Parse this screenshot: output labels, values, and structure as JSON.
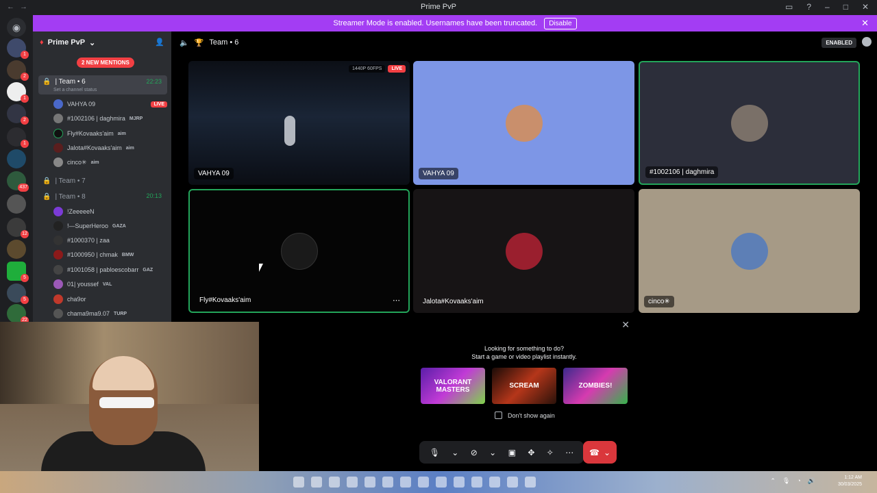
{
  "window": {
    "title": "Prime PvP"
  },
  "banner": {
    "text": "Streamer Mode is enabled. Usernames have been truncated.",
    "disable_label": "Disable"
  },
  "server_badges": [
    "1",
    "2",
    "1",
    "2",
    "1",
    "437",
    "12",
    "5",
    "5",
    "22"
  ],
  "sidebar": {
    "server_name": "Prime PvP",
    "mentions": "2 NEW MENTIONS",
    "channel_active": {
      "name": "| Team • 6",
      "time": "22:23",
      "status": "Set a channel status"
    },
    "users": [
      {
        "name": "VAHYA 09",
        "tag": "",
        "live": "LIVE"
      },
      {
        "name": "#1002106 | daghmira",
        "tag": "MJRP"
      },
      {
        "name": "Fly#Kovaaks'aim",
        "tag": "aim"
      },
      {
        "name": "Jalota#Kovaaks'aim",
        "tag": "aim"
      },
      {
        "name": "cinco✳",
        "tag": "aim"
      }
    ],
    "channel_7": "| Team • 7",
    "channel_8": {
      "name": "| Team • 8",
      "time": "20:13"
    },
    "users_8": [
      {
        "name": "!ZeeeeeN",
        "tag": ""
      },
      {
        "name": "!—SuperHeroo",
        "tag": "GAZA"
      },
      {
        "name": "#1000370 | zaa",
        "tag": ""
      },
      {
        "name": "#1000950 | chmak",
        "tag": "BMW"
      },
      {
        "name": "#1001058 | pabloescobarr",
        "tag": "GAZ"
      },
      {
        "name": "01| youssef",
        "tag": "VAL"
      },
      {
        "name": "cha9or",
        "tag": ""
      },
      {
        "name": "chama9ma9.07",
        "tag": "TURP"
      }
    ]
  },
  "main": {
    "header_title": "Team • 6",
    "enabled_label": "ENABLED",
    "tiles": [
      {
        "name": "VAHYA 09",
        "stream_res": "1440P 60FPS",
        "live": "LIVE"
      },
      {
        "name": "VAHYA 09"
      },
      {
        "name": "#1002106 | daghmira"
      },
      {
        "name": "Fly#Kovaaks'aim"
      },
      {
        "name": "Jalota#Kovaaks'aim"
      },
      {
        "name": "cinco✳"
      }
    ]
  },
  "activity": {
    "line1": "Looking for something to do?",
    "line2": "Start a game or video playlist instantly.",
    "games": [
      "VALORANT MASTERS",
      "SCREAM",
      "ZOMBIES!"
    ],
    "dont_show": "Don't show again"
  },
  "taskbar": {
    "time": "1:12 AM",
    "date": "30/03/2025"
  },
  "colors": {
    "banner": "#a33df3",
    "live": "#f23f43",
    "speaking": "#23a55a",
    "hangup": "#da373c"
  }
}
